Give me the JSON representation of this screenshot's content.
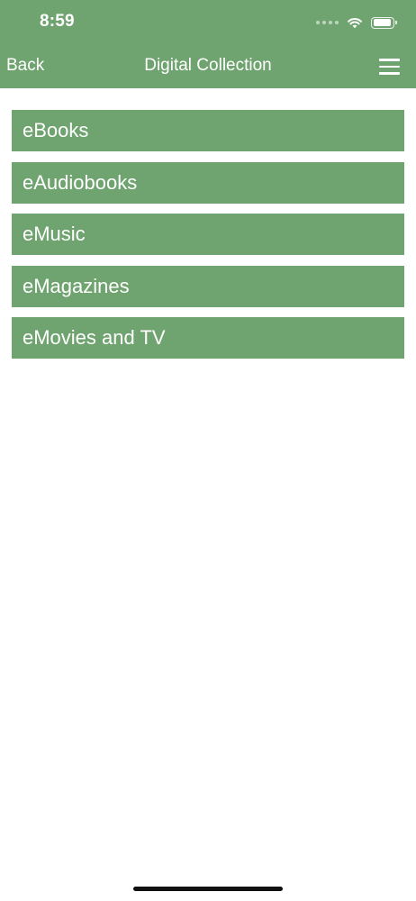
{
  "status_bar": {
    "time": "8:59",
    "icons": [
      "cellular-signal-icon",
      "wifi-icon",
      "battery-icon"
    ]
  },
  "nav": {
    "back_label": "Back",
    "title": "Digital Collection",
    "menu_icon": "hamburger-menu-icon"
  },
  "items": [
    {
      "label": "eBooks"
    },
    {
      "label": "eAudiobooks"
    },
    {
      "label": "eMusic"
    },
    {
      "label": "eMagazines"
    },
    {
      "label": "eMovies and TV"
    }
  ],
  "colors": {
    "accent": "#6fa36f",
    "background": "#ffffff",
    "text_on_accent": "#ffffff"
  }
}
